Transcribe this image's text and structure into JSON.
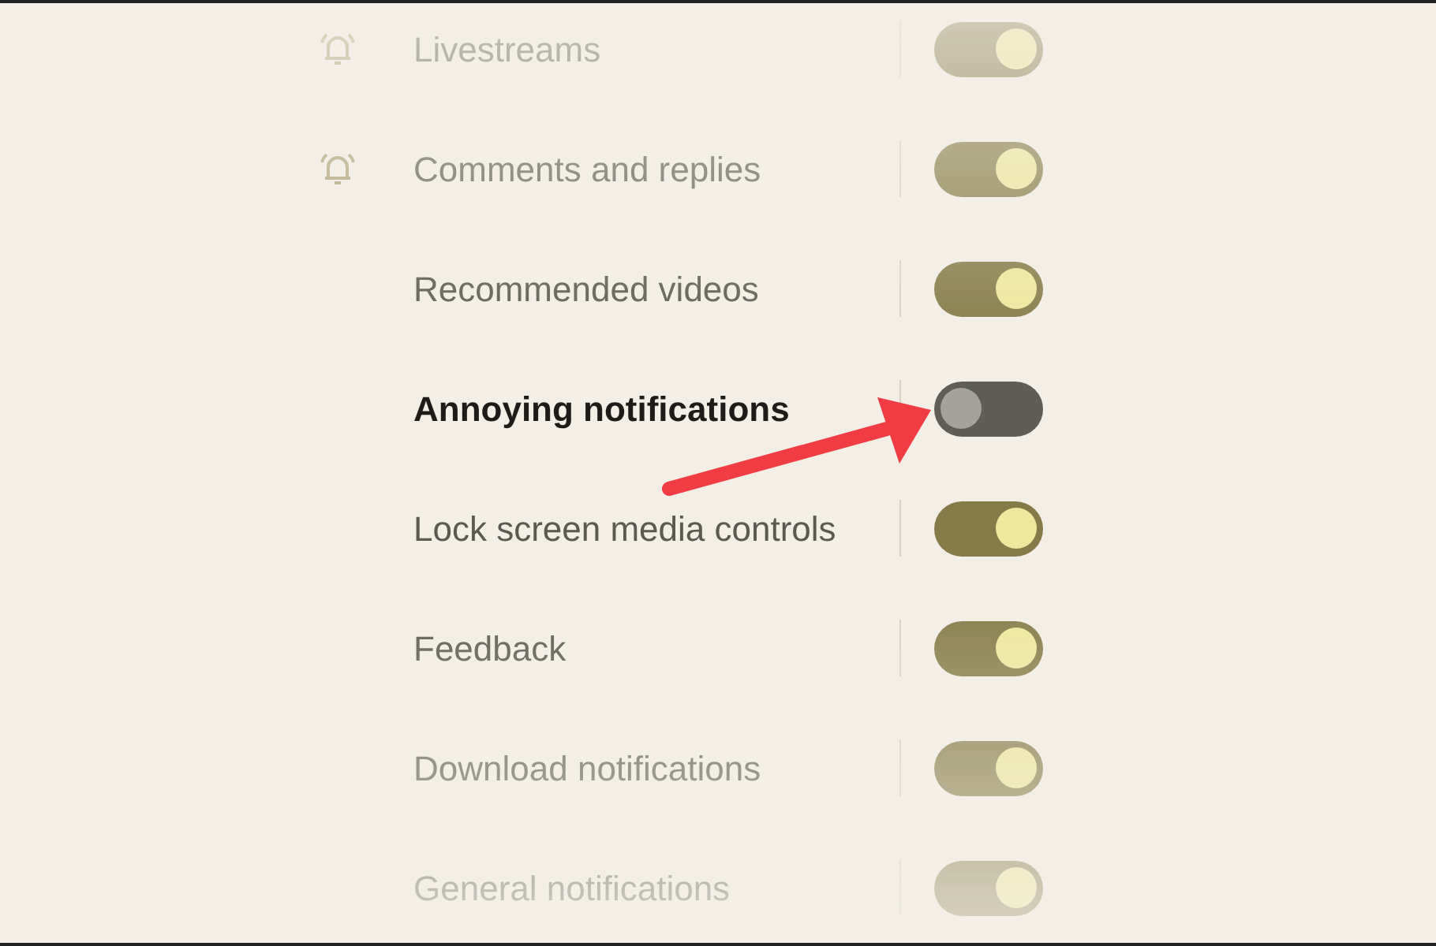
{
  "settings": [
    {
      "label": "Livestreams",
      "bell": true,
      "on": true,
      "emphasized": false,
      "arrow": false
    },
    {
      "label": "Comments and replies",
      "bell": true,
      "on": true,
      "emphasized": false,
      "arrow": false
    },
    {
      "label": "Recommended videos",
      "bell": false,
      "on": true,
      "emphasized": false,
      "arrow": false
    },
    {
      "label": "Annoying notifications",
      "bell": false,
      "on": false,
      "emphasized": true,
      "arrow": true
    },
    {
      "label": "Lock screen media controls",
      "bell": false,
      "on": true,
      "emphasized": false,
      "arrow": false
    },
    {
      "label": "Feedback",
      "bell": false,
      "on": true,
      "emphasized": false,
      "arrow": false
    },
    {
      "label": "Download notifications",
      "bell": false,
      "on": true,
      "emphasized": false,
      "arrow": false
    },
    {
      "label": "General notifications",
      "bell": false,
      "on": true,
      "emphasized": false,
      "arrow": false
    }
  ]
}
